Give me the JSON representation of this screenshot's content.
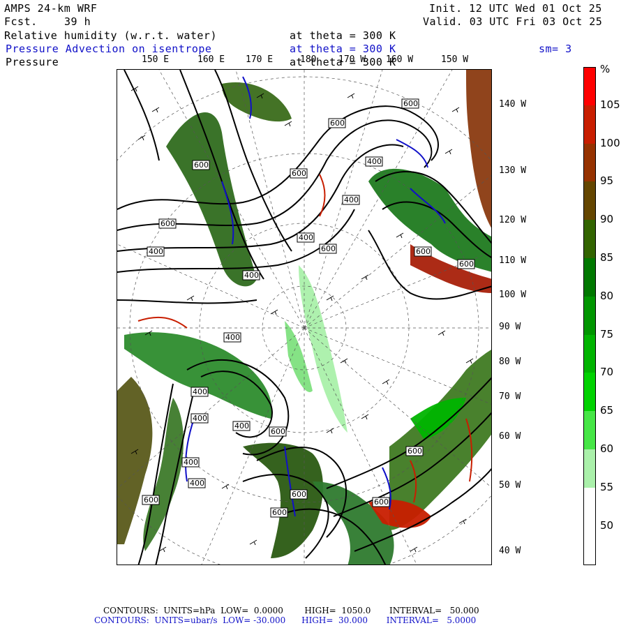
{
  "header": {
    "model": "AMPS 24-km WRF",
    "fcst_label": "Fcst.",
    "fcst_value": "39 h",
    "init": "Init. 12 UTC Wed 01 Oct 25",
    "valid": "Valid. 03 UTC Fri 03 Oct 25"
  },
  "fields": [
    {
      "name": "Relative humidity (w.r.t. water)",
      "level": "at theta = 300 K",
      "color": "#000000"
    },
    {
      "name": "Pressure Advection on isentrope",
      "level": "at theta = 300 K",
      "color": "#1010c8",
      "extra": "sm= 3"
    },
    {
      "name": "Pressure",
      "level": "at theta = 300 K",
      "color": "#000000"
    }
  ],
  "top_lon_labels": [
    "150 E",
    "160 E",
    "170 E",
    "180",
    "170 W",
    "160 W",
    "150 W"
  ],
  "right_lon_labels": [
    "140 W",
    "130 W",
    "120 W",
    "110 W",
    "100 W",
    "90 W",
    "80 W",
    "70 W",
    "60 W",
    "50 W",
    "40 W"
  ],
  "contour_labels": [
    "600",
    "600",
    "600",
    "400",
    "400",
    "600",
    "400",
    "400",
    "600",
    "400",
    "600",
    "400",
    "400",
    "400",
    "400",
    "400",
    "400",
    "600",
    "600",
    "600",
    "600",
    "600",
    "600",
    "600",
    "600"
  ],
  "colorbar": {
    "unit": "%",
    "labels": [
      "105",
      "100",
      "95",
      "90",
      "85",
      "80",
      "75",
      "70",
      "65",
      "60",
      "55",
      "50"
    ],
    "colors": [
      "#ff0000",
      "#c81e00",
      "#963200",
      "#644600",
      "#326400",
      "#007800",
      "#009600",
      "#00b400",
      "#00d200",
      "#46e646",
      "#aaf0aa",
      "#ffffff",
      "#ffffff"
    ]
  },
  "footer": {
    "line1": "CONTOURS:  UNITS=hPa  LOW=  0.0000        HIGH=  1050.0       INTERVAL=   50.000",
    "line2": "CONTOURS:  UNITS=ubar/s  LOW= -30.000      HIGH=  30.000       INTERVAL=   5.0000"
  }
}
